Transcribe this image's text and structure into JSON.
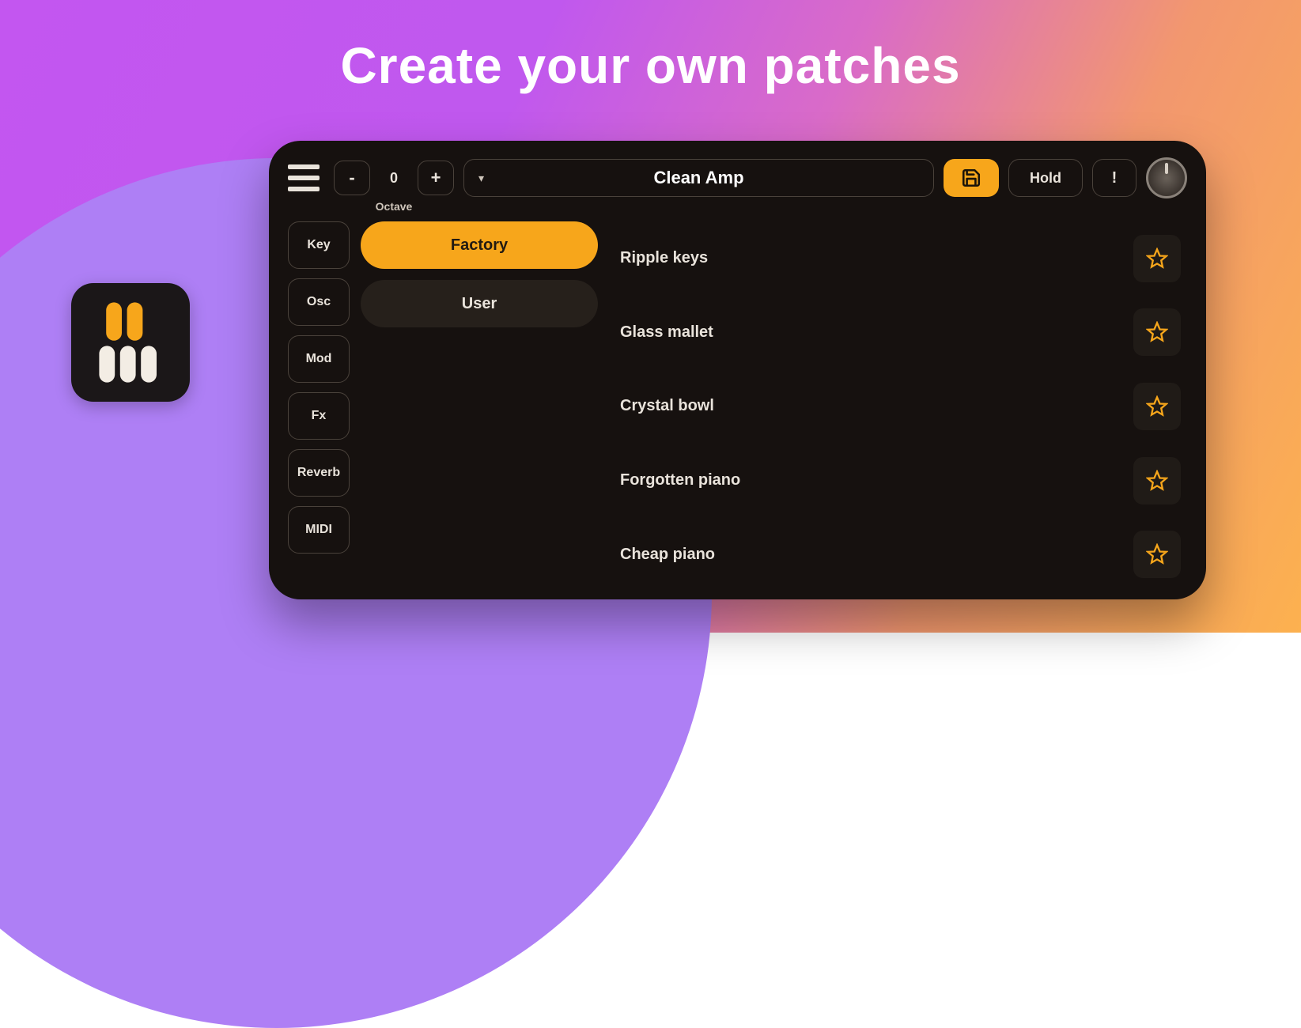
{
  "headline": "Create your own patches",
  "topbar": {
    "octave_minus": "-",
    "octave_value": "0",
    "octave_plus": "+",
    "octave_label": "Octave",
    "patch_name": "Clean Amp",
    "hold_label": "Hold",
    "panic_label": "!"
  },
  "side_tabs": [
    "Key",
    "Osc",
    "Mod",
    "Fx",
    "Reverb",
    "MIDI"
  ],
  "banks": {
    "factory": "Factory",
    "user": "User"
  },
  "patches": [
    {
      "name": "Ripple keys"
    },
    {
      "name": "Glass mallet"
    },
    {
      "name": "Crystal bowl"
    },
    {
      "name": "Forgotten piano"
    },
    {
      "name": "Cheap piano"
    }
  ],
  "colors": {
    "accent": "#f7a61b"
  }
}
